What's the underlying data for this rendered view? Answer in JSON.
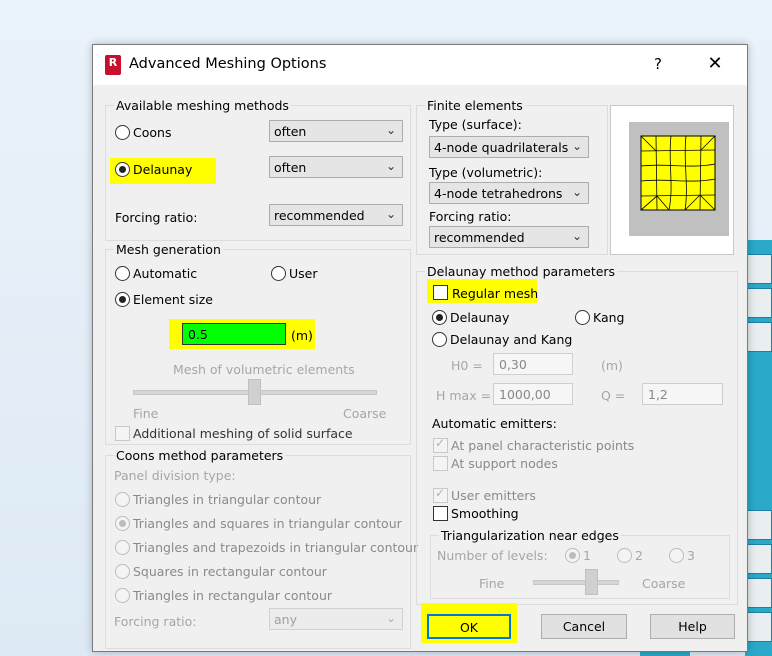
{
  "dialog": {
    "title": "Advanced Meshing Options",
    "app_icon_text": "R",
    "help": "?",
    "close": "✕"
  },
  "available_methods": {
    "title": "Available meshing methods",
    "coons_label": "Coons",
    "coons_value": "often",
    "delaunay_label": "Delaunay",
    "delaunay_value": "often",
    "forcing_label": "Forcing ratio:",
    "forcing_value": "recommended",
    "selected": "Delaunay"
  },
  "mesh_generation": {
    "title": "Mesh generation",
    "automatic_label": "Automatic",
    "user_label": "User",
    "element_size_label": "Element size",
    "element_size_value": "0.5",
    "unit": "(m)",
    "volumetric_label": "Mesh of volumetric elements",
    "fine_label": "Fine",
    "coarse_label": "Coarse",
    "additional_label": "Additional meshing of solid surface",
    "selected": "Element size"
  },
  "coons_params": {
    "title": "Coons method parameters",
    "panel_division_label": "Panel division type:",
    "options": [
      "Triangles in triangular contour",
      "Triangles and squares in triangular contour",
      "Triangles and trapezoids in triangular contour",
      "Squares in rectangular contour",
      "Triangles in rectangular contour"
    ],
    "selected_index": 1,
    "forcing_label": "Forcing ratio:",
    "forcing_value": "any"
  },
  "finite_elements": {
    "title": "Finite elements",
    "type_surface_label": "Type (surface):",
    "type_surface_value": "4-node quadrilaterals",
    "type_volumetric_label": "Type (volumetric):",
    "type_volumetric_value": "4-node tetrahedrons",
    "forcing_label": "Forcing ratio:",
    "forcing_value": "recommended"
  },
  "delaunay_params": {
    "title": "Delaunay method parameters",
    "regular_mesh_label": "Regular mesh",
    "delaunay_label": "Delaunay",
    "kang_label": "Kang",
    "delaunay_kang_label": "Delaunay and Kang",
    "selected": "Delaunay",
    "h0_label": "H0 =",
    "h0_value": "0,30",
    "h0_unit": "(m)",
    "hmax_label": "H max =",
    "hmax_value": "1000,00",
    "q_label": "Q =",
    "q_value": "1,2",
    "auto_emitters_label": "Automatic emitters:",
    "panel_points_label": "At panel characteristic points",
    "support_nodes_label": "At support nodes",
    "user_emitters_label": "User emitters",
    "smoothing_label": "Smoothing",
    "triang_title": "Triangularization near edges",
    "levels_label": "Number of levels:",
    "level_1": "1",
    "level_2": "2",
    "level_3": "3",
    "fine_label": "Fine",
    "coarse_label": "Coarse"
  },
  "buttons": {
    "ok": "OK",
    "cancel": "Cancel",
    "help": "Help"
  },
  "colors": {
    "highlight": "#ffff00",
    "edit_highlight": "#00ff00",
    "mesh_fill": "#ffff00"
  }
}
